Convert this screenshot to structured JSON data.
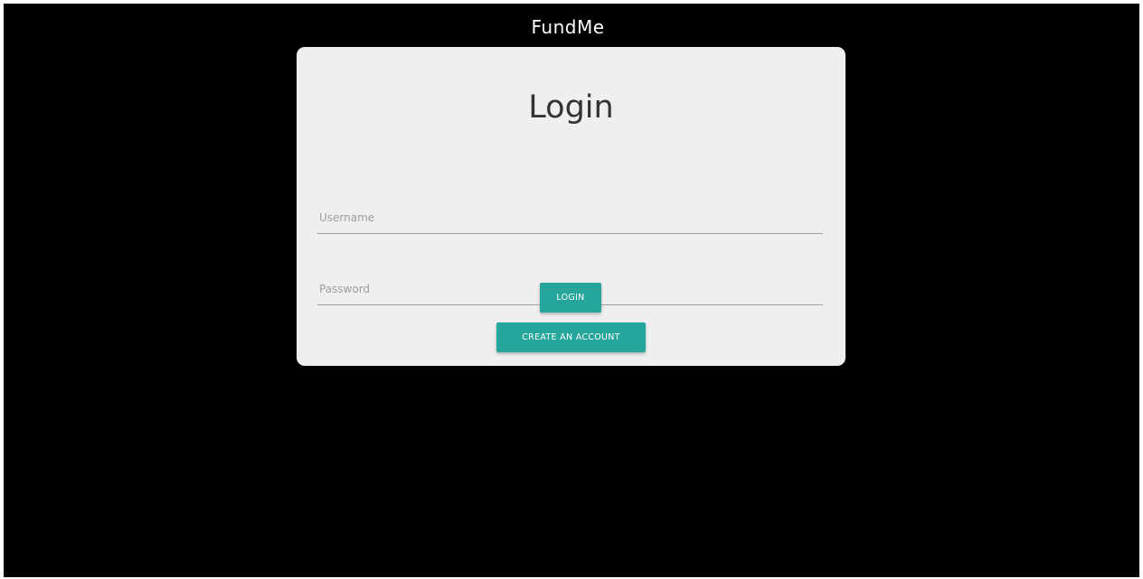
{
  "app": {
    "title": "FundMe"
  },
  "login_card": {
    "heading": "Login",
    "username": {
      "placeholder": "Username",
      "value": ""
    },
    "password": {
      "placeholder": "Password",
      "value": ""
    },
    "login_button": "LOGIN",
    "create_account_button": "CREATE AN ACCOUNT"
  },
  "colors": {
    "background": "#000000",
    "card": "#efefef",
    "accent": "#26a69a",
    "heading_text": "#333333",
    "placeholder_text": "#9e9e9e"
  }
}
